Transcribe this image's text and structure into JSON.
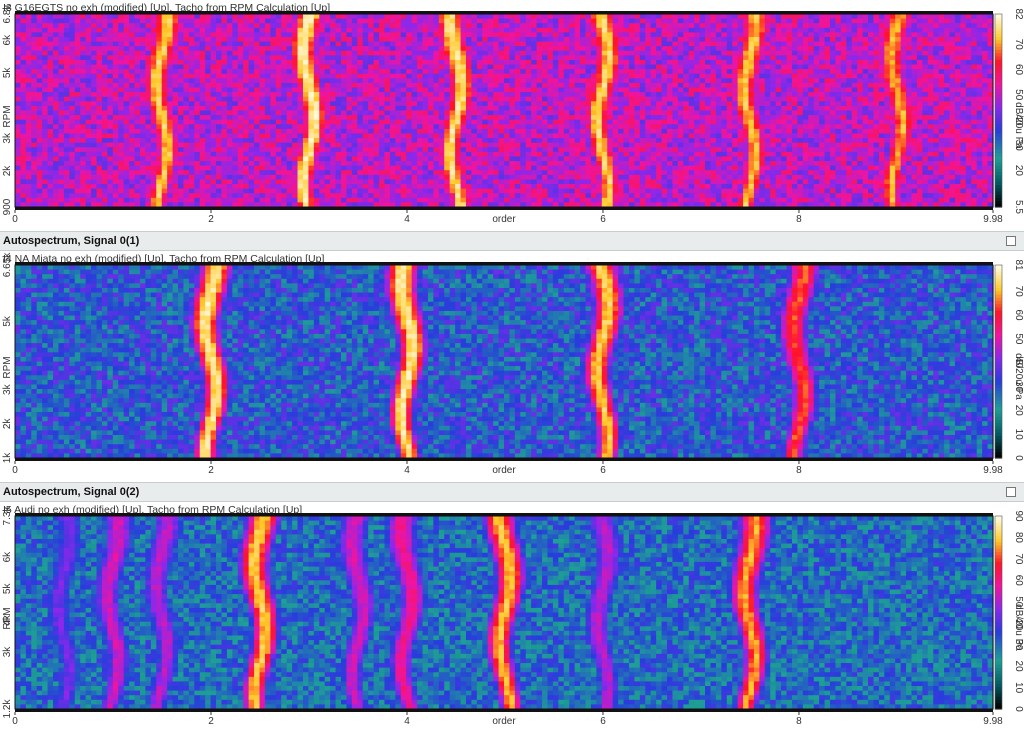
{
  "chart_data": [
    {
      "type": "heatmap",
      "label": "I3 G16EGTS no exh (modified) [Up], Tacho from RPM Calculation [Up]",
      "xlabel": "order",
      "ylabel": "RPM",
      "x_ticks": [
        "0",
        "2",
        "4",
        "6",
        "8",
        "9.98"
      ],
      "x_tick_values": [
        0,
        2,
        4,
        6,
        8,
        9.98
      ],
      "xlim": [
        0,
        9.98
      ],
      "y_ticks": [
        "900",
        "2k",
        "3k",
        "5k",
        "6k",
        "6.8k"
      ],
      "y_tick_values": [
        900,
        2000,
        3000,
        5000,
        6000,
        6800
      ],
      "ylim": [
        900,
        6800
      ],
      "colorbar_label": "dB/20u Pa",
      "colorbar_ticks": [
        "5.5",
        "20",
        "30",
        "40",
        "50",
        "60",
        "70",
        "82"
      ],
      "colorbar_tick_values": [
        5.5,
        20,
        30,
        40,
        50,
        60,
        70,
        82
      ],
      "colorbar_range": [
        5.5,
        82
      ],
      "baseline_db": 50,
      "order_lines": [
        {
          "order": 1.5,
          "level_db": 75
        },
        {
          "order": 3.0,
          "level_db": 80
        },
        {
          "order": 4.5,
          "level_db": 78
        },
        {
          "order": 6.0,
          "level_db": 76
        },
        {
          "order": 7.5,
          "level_db": 74
        },
        {
          "order": 9.0,
          "level_db": 72
        }
      ]
    },
    {
      "type": "heatmap",
      "header": "Autospectrum, Signal 0(1)",
      "label": "I4 NA Miata no exh (modified) [Up], Tacho from RPM Calculation [Up]",
      "xlabel": "order",
      "ylabel": "RPM",
      "x_ticks": [
        "0",
        "2",
        "4",
        "6",
        "8",
        "9.98"
      ],
      "x_tick_values": [
        0,
        2,
        4,
        6,
        8,
        9.98
      ],
      "xlim": [
        0,
        9.98
      ],
      "y_ticks": [
        "1k",
        "2k",
        "3k",
        "5k",
        "6.65k"
      ],
      "y_tick_values": [
        1000,
        2000,
        3000,
        5000,
        6650
      ],
      "ylim": [
        1000,
        6650
      ],
      "colorbar_label": "dB/20u Pa",
      "colorbar_ticks": [
        "0",
        "10",
        "20",
        "30",
        "40",
        "50",
        "60",
        "70",
        "81"
      ],
      "colorbar_tick_values": [
        0,
        10,
        20,
        30,
        40,
        50,
        60,
        70,
        81
      ],
      "colorbar_range": [
        0,
        81
      ],
      "baseline_db": 30,
      "order_lines": [
        {
          "order": 2.0,
          "level_db": 78
        },
        {
          "order": 4.0,
          "level_db": 78
        },
        {
          "order": 6.0,
          "level_db": 74
        },
        {
          "order": 8.0,
          "level_db": 65
        }
      ]
    },
    {
      "type": "heatmap",
      "header": "Autospectrum, Signal 0(2)",
      "label": "I5 Audi no exh (modified) [Up], Tacho from RPM Calculation [Up]",
      "xlabel": "order",
      "ylabel": "RPM",
      "x_ticks": [
        "0",
        "2",
        "4",
        "6",
        "8",
        "9.98"
      ],
      "x_tick_values": [
        0,
        2,
        4,
        6,
        8,
        9.98
      ],
      "xlim": [
        0,
        9.98
      ],
      "y_ticks": [
        "1.2k",
        "3k",
        "4k",
        "5k",
        "6k",
        "7.3k"
      ],
      "y_tick_values": [
        1200,
        3000,
        4000,
        5000,
        6000,
        7300
      ],
      "ylim": [
        1200,
        7300
      ],
      "colorbar_label": "dB/20u Pa",
      "colorbar_ticks": [
        "0",
        "10",
        "20",
        "30",
        "40",
        "50",
        "60",
        "70",
        "80",
        "90"
      ],
      "colorbar_tick_values": [
        0,
        10,
        20,
        30,
        40,
        50,
        60,
        70,
        80,
        90
      ],
      "colorbar_range": [
        0,
        90
      ],
      "baseline_db": 30,
      "order_lines": [
        {
          "order": 0.5,
          "level_db": 45
        },
        {
          "order": 1.0,
          "level_db": 55
        },
        {
          "order": 1.5,
          "level_db": 52
        },
        {
          "order": 2.5,
          "level_db": 82
        },
        {
          "order": 3.5,
          "level_db": 55
        },
        {
          "order": 4.0,
          "level_db": 60
        },
        {
          "order": 5.0,
          "level_db": 80
        },
        {
          "order": 6.0,
          "level_db": 52
        },
        {
          "order": 7.5,
          "level_db": 78
        }
      ]
    }
  ]
}
